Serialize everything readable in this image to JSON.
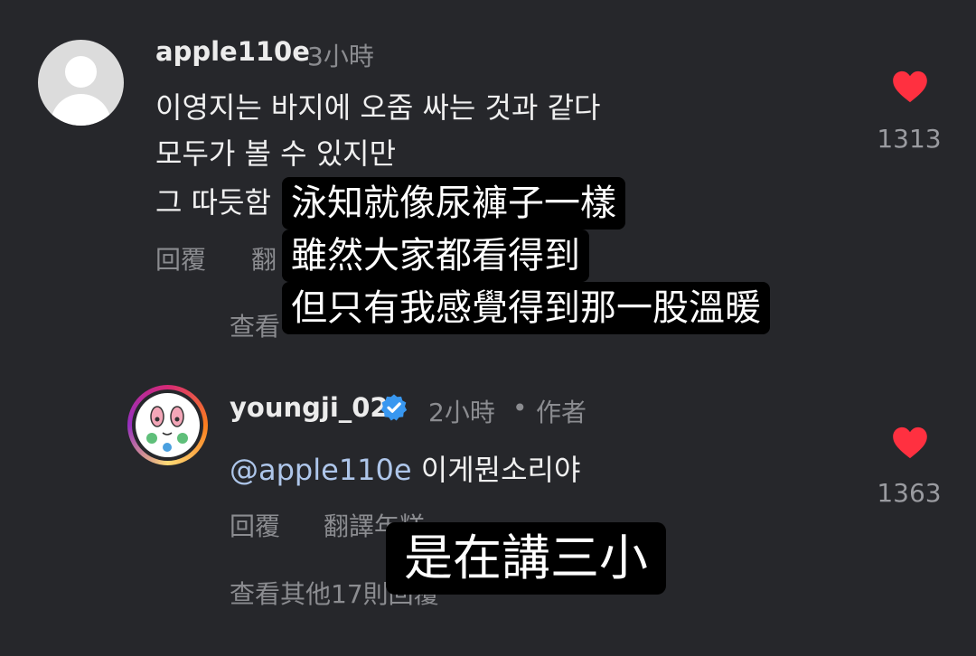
{
  "comment1": {
    "username": "apple110e",
    "time": "3小時",
    "lines": [
      "이영지는 바지에 오줌 싸는 것과 같다",
      "모두가 볼 수 있지만",
      "그 따듯함"
    ],
    "reply": "回覆",
    "translate": "翻",
    "view_replies": "查看",
    "likes": "1313"
  },
  "comment2": {
    "username": "youngji_02",
    "time": "2小時",
    "separator": "•",
    "author_tag": "作者",
    "mention": "@apple110e",
    "text": "이게뭔소리야",
    "reply": "回覆",
    "translate": "翻譯年糕",
    "view_replies": "查看其他17則回覆",
    "likes": "1363"
  },
  "subtitles": {
    "top": [
      "泳知就像尿褲子一樣",
      "雖然大家都看得到",
      "但只有我感覺得到那一股溫暖"
    ],
    "bottom": "是在講三小"
  },
  "colors": {
    "background": "#26272b",
    "heart": "#ff3040",
    "verified": "#3897f0",
    "mention": "#aec6ea"
  }
}
